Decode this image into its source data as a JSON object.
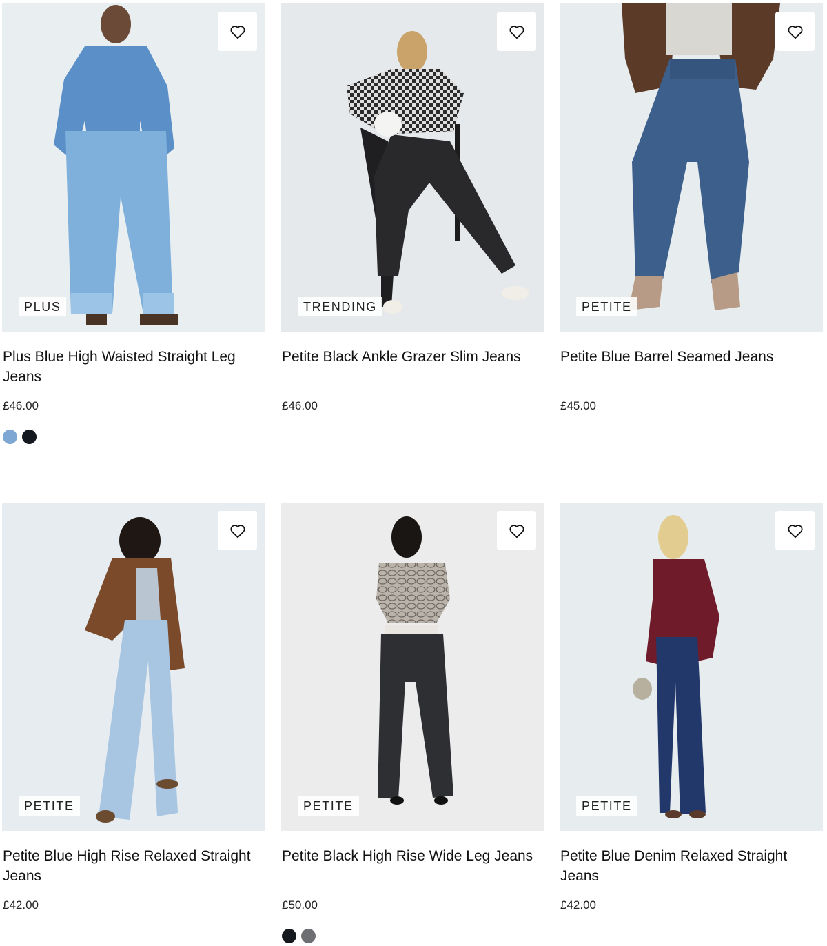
{
  "products": [
    {
      "badge": "PLUS",
      "title": "Plus Blue High Waisted Straight Leg Jeans",
      "price": "£46.00",
      "swatches": [
        {
          "name": "light-blue",
          "color": "#7ea8d3"
        },
        {
          "name": "black",
          "color": "#14191f"
        }
      ]
    },
    {
      "badge": "TRENDING",
      "title": "Petite Black Ankle Grazer Slim Jeans",
      "price": "£46.00",
      "swatches": []
    },
    {
      "badge": "PETITE",
      "title": "Petite Blue Barrel Seamed Jeans",
      "price": "£45.00",
      "swatches": []
    },
    {
      "badge": "PETITE",
      "title": "Petite Blue High Rise Relaxed Straight Jeans",
      "price": "£42.00",
      "swatches": []
    },
    {
      "badge": "PETITE",
      "title": "Petite Black High Rise Wide Leg Jeans",
      "price": "£50.00",
      "swatches": [
        {
          "name": "black",
          "color": "#15181c"
        },
        {
          "name": "grey",
          "color": "#6d6f72"
        }
      ]
    },
    {
      "badge": "PETITE",
      "title": "Petite Blue Denim Relaxed Straight Jeans",
      "price": "£42.00",
      "swatches": []
    }
  ],
  "icons": {
    "wishlist": "heart-outline-icon"
  },
  "colors": {
    "text": "#111111",
    "badge_background": "#ffffff",
    "photo_background": "#e8ecef"
  }
}
